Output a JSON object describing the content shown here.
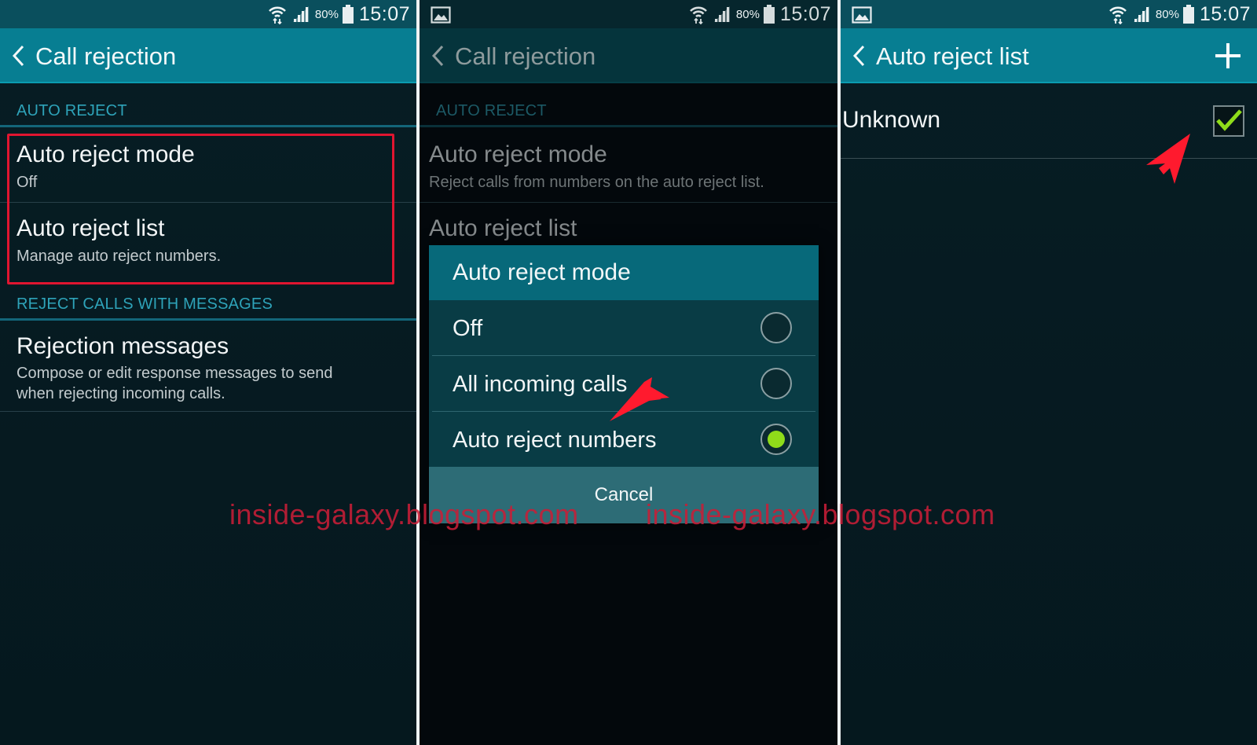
{
  "status_bar": {
    "battery_percent": "80%",
    "time": "15:07",
    "icons": [
      "wifi-icon",
      "signal-icon",
      "battery-icon"
    ],
    "notification_icons": [
      "gallery-icon"
    ]
  },
  "panels": [
    {
      "id": "call-rejection",
      "action_bar": {
        "back_icon": "chevron-left-icon",
        "title": "Call rejection"
      },
      "sections": [
        {
          "header": "AUTO REJECT",
          "items": [
            {
              "primary": "Auto reject mode",
              "secondary": "Off"
            },
            {
              "primary": "Auto reject list",
              "secondary": "Manage auto reject numbers."
            }
          ]
        },
        {
          "header": "REJECT CALLS WITH MESSAGES",
          "items": [
            {
              "primary": "Rejection messages",
              "secondary_lines": [
                "Compose or edit response messages to send",
                "when rejecting incoming calls."
              ]
            }
          ]
        }
      ]
    },
    {
      "id": "call-rejection-dialog",
      "action_bar": {
        "back_icon": "chevron-left-icon",
        "title": "Call rejection"
      },
      "sections": [
        {
          "header": "AUTO REJECT",
          "items": [
            {
              "primary": "Auto reject mode",
              "secondary": "Reject calls from numbers on the auto reject list."
            },
            {
              "primary": "Auto reject list"
            }
          ]
        }
      ],
      "dialog": {
        "title": "Auto reject mode",
        "options": [
          {
            "label": "Off",
            "selected": false
          },
          {
            "label": "All incoming calls",
            "selected": false
          },
          {
            "label": "Auto reject numbers",
            "selected": true
          }
        ],
        "cancel_label": "Cancel"
      }
    },
    {
      "id": "auto-reject-list",
      "action_bar": {
        "back_icon": "chevron-left-icon",
        "title": "Auto reject list",
        "action_icon": "plus-icon"
      },
      "items": [
        {
          "label": "Unknown",
          "checked": true
        }
      ]
    }
  ],
  "watermark": "inside-galaxy.blogspot.com",
  "colors": {
    "action_bar": "#077e92",
    "section_header": "#2ea3b9",
    "highlight": "#e01530",
    "radio_selected": "#8fdc1a",
    "check": "#8fdc1a",
    "annotation_arrow": "#ff1a2e"
  }
}
